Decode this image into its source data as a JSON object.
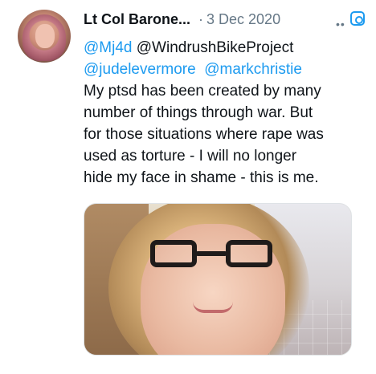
{
  "tweet": {
    "author": {
      "display_name": "Lt Col Barone..."
    },
    "separator": "·",
    "date": "3 Dec 2020",
    "body": {
      "line1": {
        "m1": "@Mj4d",
        "rest": " @WindrushBikeProject"
      },
      "line2": {
        "m1": "@judelevermore",
        "m2": "@markchristie"
      },
      "line3": "My ptsd has been created by many",
      "line4": "number of things through war. But",
      "line5": "for those situations where rape was",
      "line6": "used as torture - I will no longer",
      "line7": "hide my face in shame - this is me."
    },
    "colors": {
      "link": "#1d9bf0",
      "text": "#0f1419",
      "secondary": "#657786"
    },
    "icons": {
      "more": "more-icon",
      "image_lens": "lens-icon"
    }
  }
}
